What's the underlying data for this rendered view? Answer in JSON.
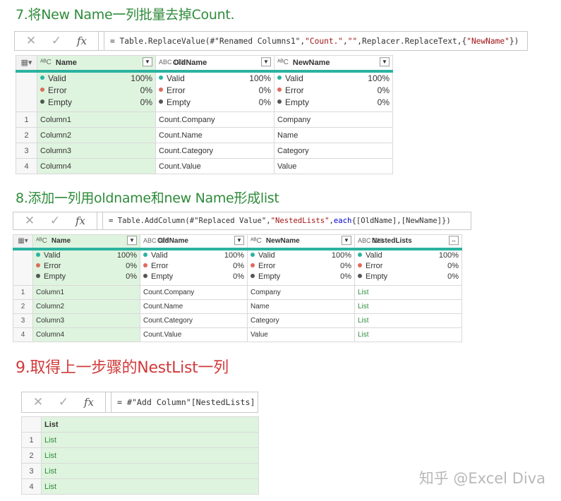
{
  "step7": {
    "title": "7.将New Name一列批量去掉Count.",
    "formula_prefix": "= Table.ReplaceValue(#\"Renamed Columns1\",",
    "formula_str1": "\"Count.\"",
    "formula_mid": ",",
    "formula_str2": "\"\"",
    "formula_mid2": ",Replacer.ReplaceText,{",
    "formula_str3": "\"NewName\"",
    "formula_suffix": "})",
    "columns": [
      {
        "type": "ABC",
        "name": "Name"
      },
      {
        "type": "ABC123",
        "name": "OldName"
      },
      {
        "type": "ABC",
        "name": "NewName"
      }
    ],
    "stats": [
      {
        "valid": "100%",
        "error": "0%",
        "empty": "0%"
      },
      {
        "valid": "100%",
        "error": "0%",
        "empty": "0%"
      },
      {
        "valid": "100%",
        "error": "0%",
        "empty": "0%"
      }
    ],
    "rows": [
      [
        "1",
        "Column1",
        "Count.Company",
        "Company"
      ],
      [
        "2",
        "Column2",
        "Count.Name",
        "Name"
      ],
      [
        "3",
        "Column3",
        "Count.Category",
        "Category"
      ],
      [
        "4",
        "Column4",
        "Count.Value",
        "Value"
      ]
    ]
  },
  "step8": {
    "title": "8.添加一列用oldname和new Name形成list",
    "formula_prefix": "= Table.AddColumn(#\"Replaced Value\", ",
    "formula_str1": "\"NestedLists\"",
    "formula_mid": ", ",
    "formula_kw": "each",
    "formula_suffix": " {[OldName],[NewName]})",
    "columns": [
      {
        "type": "ABC",
        "name": "Name"
      },
      {
        "type": "ABC123",
        "name": "OldName"
      },
      {
        "type": "ABC",
        "name": "NewName"
      },
      {
        "type": "ABC123",
        "name": "NestedLists"
      }
    ],
    "stats": [
      {
        "valid": "100%",
        "error": "0%",
        "empty": "0%"
      },
      {
        "valid": "100%",
        "error": "0%",
        "empty": "0%"
      },
      {
        "valid": "100%",
        "error": "0%",
        "empty": "0%"
      },
      {
        "valid": "100%",
        "error": "0%",
        "empty": "0%"
      }
    ],
    "rows": [
      [
        "1",
        "Column1",
        "Count.Company",
        "Company",
        "List"
      ],
      [
        "2",
        "Column2",
        "Count.Name",
        "Name",
        "List"
      ],
      [
        "3",
        "Column3",
        "Count.Category",
        "Category",
        "List"
      ],
      [
        "4",
        "Column4",
        "Count.Value",
        "Value",
        "List"
      ]
    ]
  },
  "step9": {
    "title": "9.取得上一步骤的NestList一列",
    "formula": "= #\"Add Column\"[NestedLists]",
    "column": "List",
    "rows": [
      [
        "1",
        "List"
      ],
      [
        "2",
        "List"
      ],
      [
        "3",
        "List"
      ],
      [
        "4",
        "List"
      ]
    ]
  },
  "labels": {
    "valid": "Valid",
    "error": "Error",
    "empty": "Empty",
    "cancel_glyph": "✕",
    "commit_glyph": "✓",
    "fx_glyph": "fx",
    "type_abc": "ᴬᴮC",
    "type_abc123": "ABC 123",
    "dropdown_glyph": "▼",
    "expand_glyph": "↔"
  },
  "watermark": "知乎 @Excel Diva"
}
